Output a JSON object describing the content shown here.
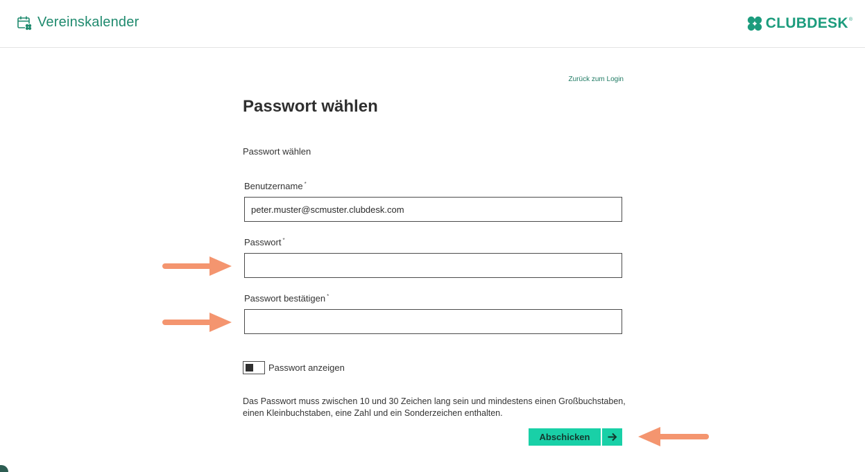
{
  "header": {
    "app_title": "Vereinskalender",
    "app_icon": "calendar-clover-icon",
    "brand_name": "CLUBDESK",
    "brand_mark": "®",
    "brand_icon": "clover-icon"
  },
  "form": {
    "back_link": "Zurück zum Login",
    "title": "Passwort wählen",
    "subtitle": "Passwort wählen",
    "required_marker": "*",
    "fields": [
      {
        "label": "Benutzername",
        "value": "peter.muster@scmuster.clubdesk.com",
        "placeholder": ""
      },
      {
        "label": "Passwort",
        "value": "",
        "placeholder": ""
      },
      {
        "label": "Passwort bestätigen",
        "value": "",
        "placeholder": ""
      }
    ],
    "show_password_label": "Passwort anzeigen",
    "hint": "Das Passwort muss zwischen 10 und 30 Zeichen lang sein und mindestens einen Großbuchstaben, einen Kleinbuchstaben, eine Zahl und ein Sonderzeichen enthalten.",
    "submit_label": "Abschicken",
    "submit_icon": "arrow-right-icon"
  },
  "colors": {
    "accent": "#19d0a7",
    "brand": "#1c9c7d",
    "annotation_arrow": "#f4956f"
  }
}
